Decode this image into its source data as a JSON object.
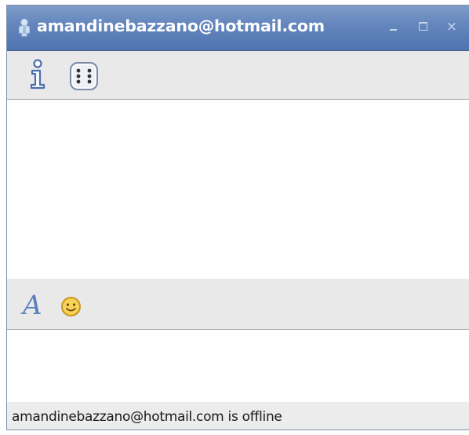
{
  "window": {
    "title": "amandinebazzano@hotmail.com",
    "title_icon": "contact-person-icon",
    "buttons": {
      "minimize_icon": "minimize-icon",
      "maximize_icon": "maximize-icon",
      "close_label": "×"
    }
  },
  "toolbar_top": {
    "items": [
      {
        "icon": "info-icon"
      },
      {
        "icon": "dice-icon"
      }
    ]
  },
  "history": {
    "content": ""
  },
  "toolbar_format": {
    "font_label": "A",
    "items": [
      {
        "icon": "font-icon"
      },
      {
        "icon": "smiley-icon"
      }
    ]
  },
  "input": {
    "value": ""
  },
  "status": {
    "text": "amandinebazzano@hotmail.com is offline"
  },
  "colors": {
    "titlebar": "#5c7fb8",
    "toolbar_bg": "#e9e9e9",
    "pane_bg": "#ffffff",
    "font_icon": "#5a7fbf",
    "smiley": "#f2c14a"
  }
}
